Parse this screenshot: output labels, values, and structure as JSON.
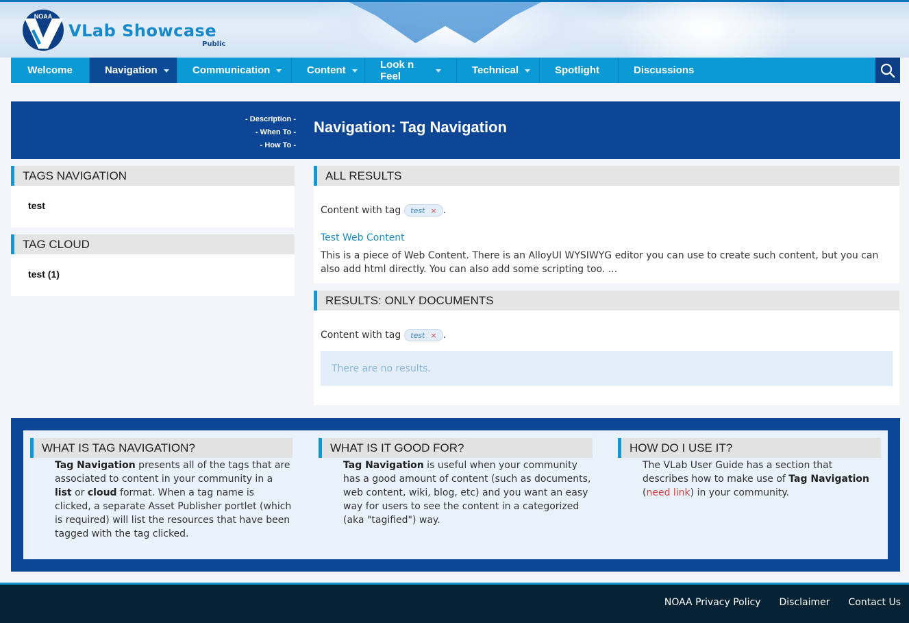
{
  "header": {
    "logo_text": "NOAA",
    "site_title": "VLab Showcase",
    "site_subtitle": "Public"
  },
  "nav": {
    "items": [
      {
        "label": "Welcome",
        "dropdown": false,
        "active": false
      },
      {
        "label": "Navigation",
        "dropdown": true,
        "active": true
      },
      {
        "label": "Communication",
        "dropdown": true,
        "active": false
      },
      {
        "label": "Content",
        "dropdown": true,
        "active": false
      },
      {
        "label": "Look n Feel",
        "dropdown": true,
        "active": false
      },
      {
        "label": "Technical",
        "dropdown": true,
        "active": false
      },
      {
        "label": "Spotlight",
        "dropdown": false,
        "active": false
      },
      {
        "label": "Discussions",
        "dropdown": false,
        "active": false
      }
    ]
  },
  "title_band": {
    "anchors": [
      "- Description -",
      "- When To -",
      "- How To -"
    ],
    "title": "Navigation: Tag Navigation"
  },
  "tags_nav": {
    "heading": "TAGS NAVIGATION",
    "item": "test"
  },
  "tag_cloud": {
    "heading": "TAG CLOUD",
    "item": "test (1)"
  },
  "all_results": {
    "heading": "ALL RESULTS",
    "content_with": "Content with tag",
    "chip": "test",
    "chip_remove": "×",
    "period": ".",
    "link": "Test Web Content",
    "desc": "This is a piece of Web Content.  There is an AlloyUI WYSIWYG editor you can use to create such content, but you can also add html directly.  You can also add some scripting too. ..."
  },
  "doc_results": {
    "heading": "RESULTS: ONLY DOCUMENTS",
    "content_with": "Content with tag",
    "chip": "test",
    "chip_remove": "×",
    "period": ".",
    "empty": "There are no results."
  },
  "info": {
    "what": {
      "heading": "WHAT IS TAG NAVIGATION?",
      "b1": "Tag Navigation",
      "t1": " presents all of the tags that are associated to content in your community in a ",
      "b2": "list",
      "t2": " or ",
      "b3": "cloud",
      "t3": " format.  When a tag name is clicked, a separate Asset Publisher portlet (which is required) will list the resources that have been tagged with the tag clicked."
    },
    "good": {
      "heading": "WHAT IS IT GOOD FOR?",
      "b1": "Tag Navigation",
      "t1": " is useful when your community has a good amount of content (such as documents, web content, wiki, blog, etc) and you want an easy way for users to see the content in a categorized (aka \"tagified\") way."
    },
    "how": {
      "heading": "HOW DO I USE IT?",
      "t1": "The VLab User Guide has a section that describes how to make use of ",
      "b1": "Tag Navigation",
      "t2": " (",
      "link": "need link",
      "t3": ") in your community."
    }
  },
  "footer": {
    "links": [
      "NOAA Privacy Policy",
      "Disclaimer",
      "Contact Us"
    ]
  },
  "colors": {
    "nav_blue": "#0c9ad6",
    "dark_blue": "#0d4696",
    "footer_bg": "#062335"
  }
}
